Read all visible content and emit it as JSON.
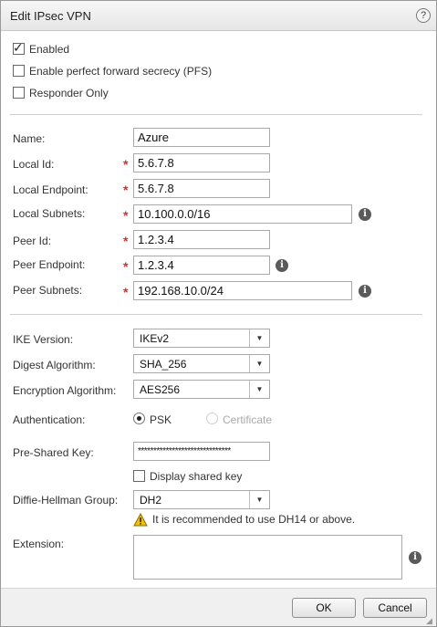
{
  "dialog": {
    "title": "Edit IPsec VPN",
    "help_symbol": "?"
  },
  "options": {
    "enabled": {
      "label": "Enabled",
      "checked": true
    },
    "pfs": {
      "label": "Enable perfect forward secrecy (PFS)",
      "checked": false
    },
    "responder_only": {
      "label": "Responder Only",
      "checked": false
    }
  },
  "fields": {
    "name": {
      "label": "Name:",
      "value": "Azure"
    },
    "local_id": {
      "label": "Local Id:",
      "value": "5.6.7.8"
    },
    "local_endpoint": {
      "label": "Local Endpoint:",
      "value": "5.6.7.8"
    },
    "local_subnets": {
      "label": "Local Subnets:",
      "value": "10.100.0.0/16"
    },
    "peer_id": {
      "label": "Peer Id:",
      "value": "1.2.3.4"
    },
    "peer_endpoint": {
      "label": "Peer Endpoint:",
      "value": "1.2.3.4"
    },
    "peer_subnets": {
      "label": "Peer Subnets:",
      "value": "192.168.10.0/24"
    },
    "required_marker": "*"
  },
  "ike": {
    "ike_version": {
      "label": "IKE Version:",
      "value": "IKEv2"
    },
    "digest": {
      "label": "Digest Algorithm:",
      "value": "SHA_256"
    },
    "encryption": {
      "label": "Encryption Algorithm:",
      "value": "AES256"
    },
    "authentication": {
      "label": "Authentication:",
      "psk_label": "PSK",
      "certificate_label": "Certificate",
      "selected": "PSK"
    },
    "pre_shared_key": {
      "label": "Pre-Shared Key:",
      "value": "******************************"
    },
    "display_shared_key": {
      "label": "Display shared key",
      "checked": false
    },
    "dh_group": {
      "label": "Diffie-Hellman Group:",
      "value": "DH2"
    },
    "dh_warning": "It is recommended to use DH14 or above.",
    "extension": {
      "label": "Extension:",
      "value": ""
    }
  },
  "footer": {
    "ok_label": "OK",
    "cancel_label": "Cancel"
  },
  "colors": {
    "required": "#d0312d",
    "warning": "#f2c200",
    "info_icon": "#5a5a5a"
  }
}
